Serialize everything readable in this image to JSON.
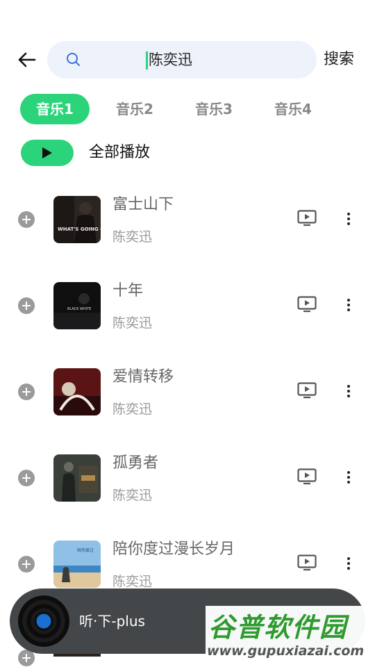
{
  "search": {
    "query": "陈奕迅",
    "clear_symbol": "×",
    "submit_label": "搜索"
  },
  "tabs": [
    {
      "label": "音乐1",
      "active": true
    },
    {
      "label": "音乐2",
      "active": false
    },
    {
      "label": "音乐3",
      "active": false
    },
    {
      "label": "音乐4",
      "active": false
    }
  ],
  "play_all": {
    "label": "全部播放"
  },
  "songs": [
    {
      "title": "富士山下",
      "artist": "陈奕迅",
      "cover_text": "WHAT'S GOING ON...?"
    },
    {
      "title": "十年",
      "artist": "陈奕迅",
      "cover_text": "BLACK WHITE"
    },
    {
      "title": "爱情转移",
      "artist": "陈奕迅",
      "cover_text": ""
    },
    {
      "title": "孤勇者",
      "artist": "陈奕迅",
      "cover_text": ""
    },
    {
      "title": "陪你度过漫长岁月",
      "artist": "陈奕迅",
      "cover_text": ""
    }
  ],
  "player": {
    "title": "听·下-plus"
  },
  "watermark": {
    "logo": "谷普软件园",
    "url": "www.gupuxiazai.com"
  },
  "colors": {
    "accent": "#2bd47a",
    "search_bg": "#eef3fb",
    "player_bg": "#444749"
  }
}
